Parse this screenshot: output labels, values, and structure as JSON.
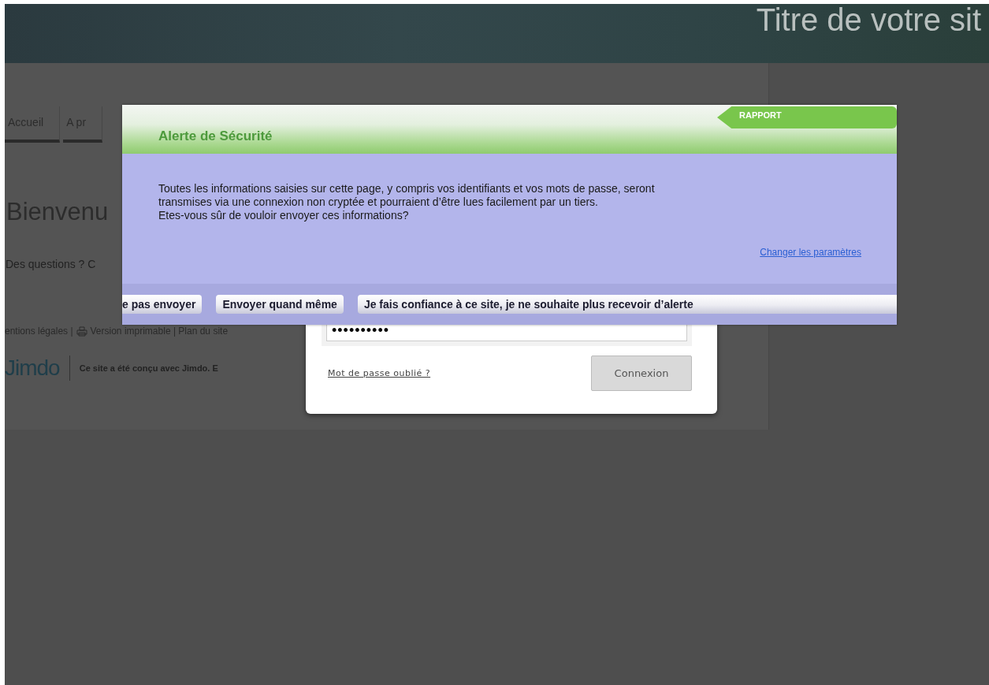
{
  "site_header": {
    "title": "Titre de votre sit"
  },
  "nav": {
    "items": [
      {
        "label": "Accueil"
      },
      {
        "label": "A pr"
      }
    ]
  },
  "page": {
    "heading": "Bienvenu",
    "text": "Des questions ? C",
    "footer_left": "entions légales |",
    "footer_right": "Version imprimable | Plan du site",
    "logo": "Jimdo",
    "credit": "Ce site a été conçu avec Jimdo. E"
  },
  "login_dialog": {
    "password_value": "••••••••••",
    "forgot_link": "Mot de passe oublié ?",
    "submit": "Connexion"
  },
  "alert": {
    "title": "Alerte de Sécurité",
    "report_tab": "RAPPORT",
    "message": "Toutes les informations saisies sur cette page, y compris vos identifiants et vos mots de passe, seront\ntransmises via une connexion non cryptée et pourraient d’être lues facilement par un tiers.\nEtes-vous sûr de vouloir envoyer ces informations?",
    "settings_link": "Changer les paramètres",
    "buttons": [
      "e pas envoyer",
      "Envoyer quand même",
      "Je fais confiance à ce site, je ne souhaite plus recevoir d’alerte"
    ]
  }
}
